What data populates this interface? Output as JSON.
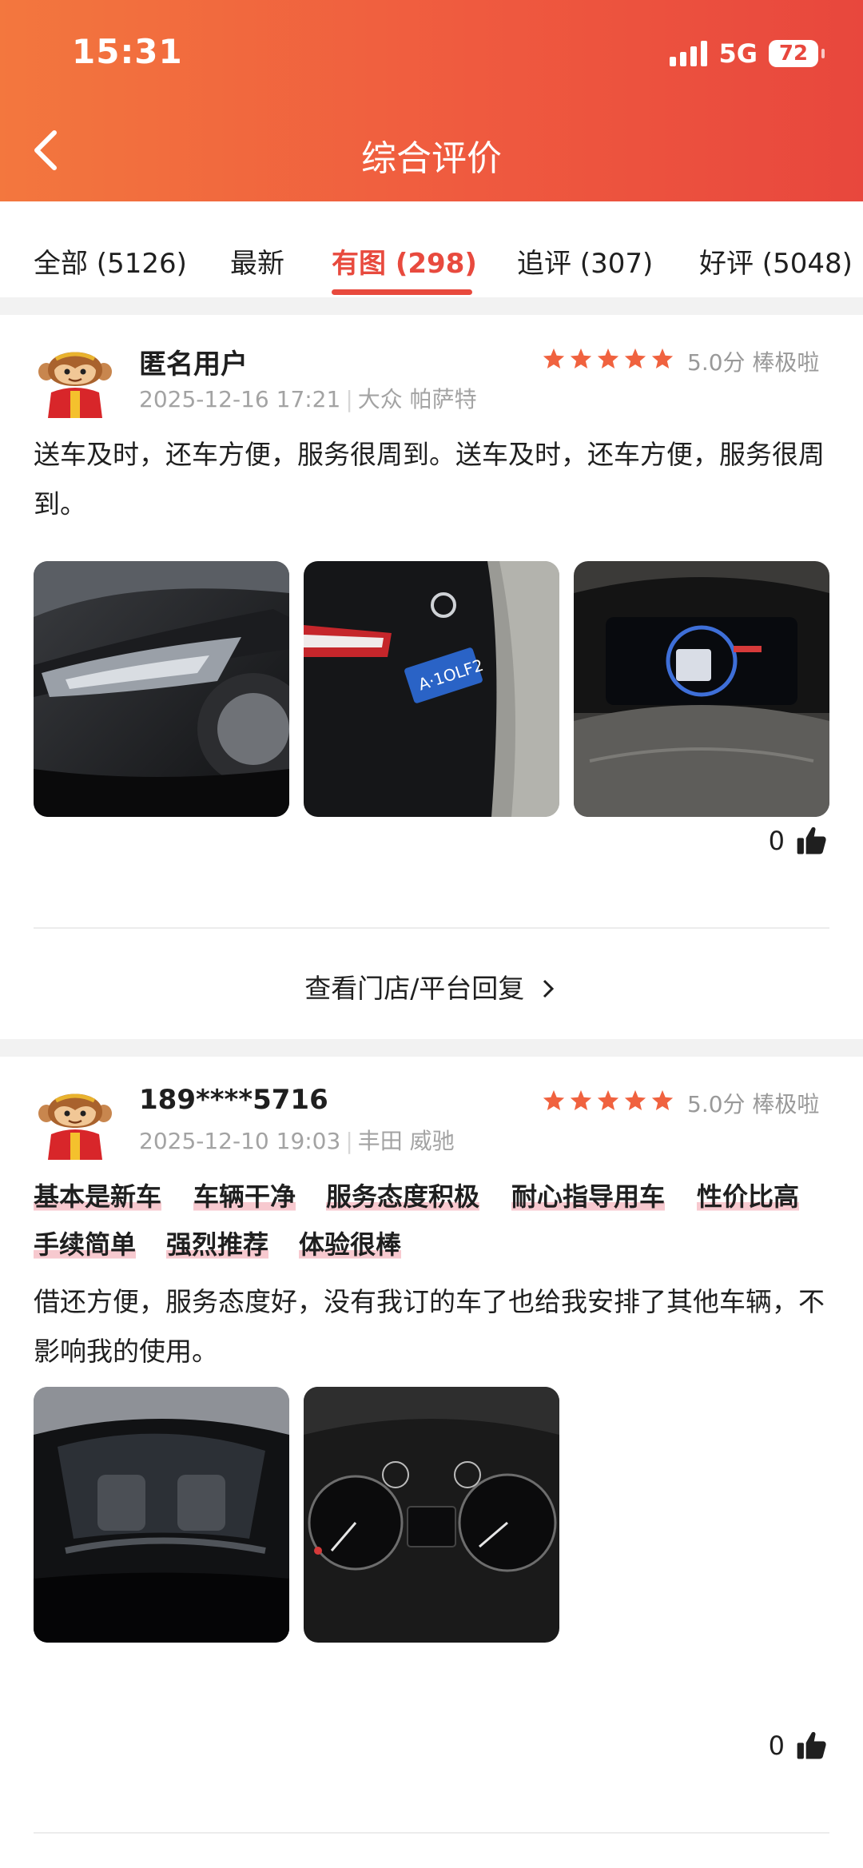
{
  "status_bar": {
    "time": "15:31",
    "network": "5G",
    "battery": "72"
  },
  "nav": {
    "title": "综合评价"
  },
  "tabs": [
    {
      "label": "全部 (5126)"
    },
    {
      "label": "最新"
    },
    {
      "label": "有图 (298)",
      "active": true
    },
    {
      "label": "追评 (307)"
    },
    {
      "label": "好评 (5048)"
    }
  ],
  "reviews": [
    {
      "user": "匿名用户",
      "datetime": "2025-12-16 17:21",
      "car": "大众 帕萨特",
      "stars": 5,
      "rating": "5.0分 棒极啦",
      "content": "送车及时，还车方便，服务很周到。送车及时，还车方便，服务很周到。",
      "photos": [
        "car-headlight-photo",
        "license-plate-photo",
        "dashboard-photo"
      ],
      "likes": "0",
      "reply_link": "查看门店/平台回复"
    },
    {
      "user": "189****5716",
      "datetime": "2025-12-10 19:03",
      "car": "丰田 威驰",
      "stars": 5,
      "rating": "5.0分 棒极啦",
      "tags": [
        "基本是新车",
        "车辆干净",
        "服务态度积极",
        "耐心指导用车",
        "性价比高",
        "手续简单",
        "强烈推荐",
        "体验很棒"
      ],
      "content": "借还方便，服务态度好，没有我订的车了也给我安排了其他车辆，不影响我的使用。",
      "photos": [
        "car-interior-photo",
        "speedometer-photo"
      ],
      "likes": "0"
    }
  ],
  "colors": {
    "accent": "#e84a3e",
    "header_start": "#f3773e",
    "header_end": "#e8473d",
    "star": "#f0623f",
    "tag_underline": "#f7c9cf"
  },
  "icons": {
    "back": "chevron-left-icon",
    "like": "thumbs-up-icon",
    "reply_arrow": "chevron-right-icon",
    "star": "star-icon"
  }
}
